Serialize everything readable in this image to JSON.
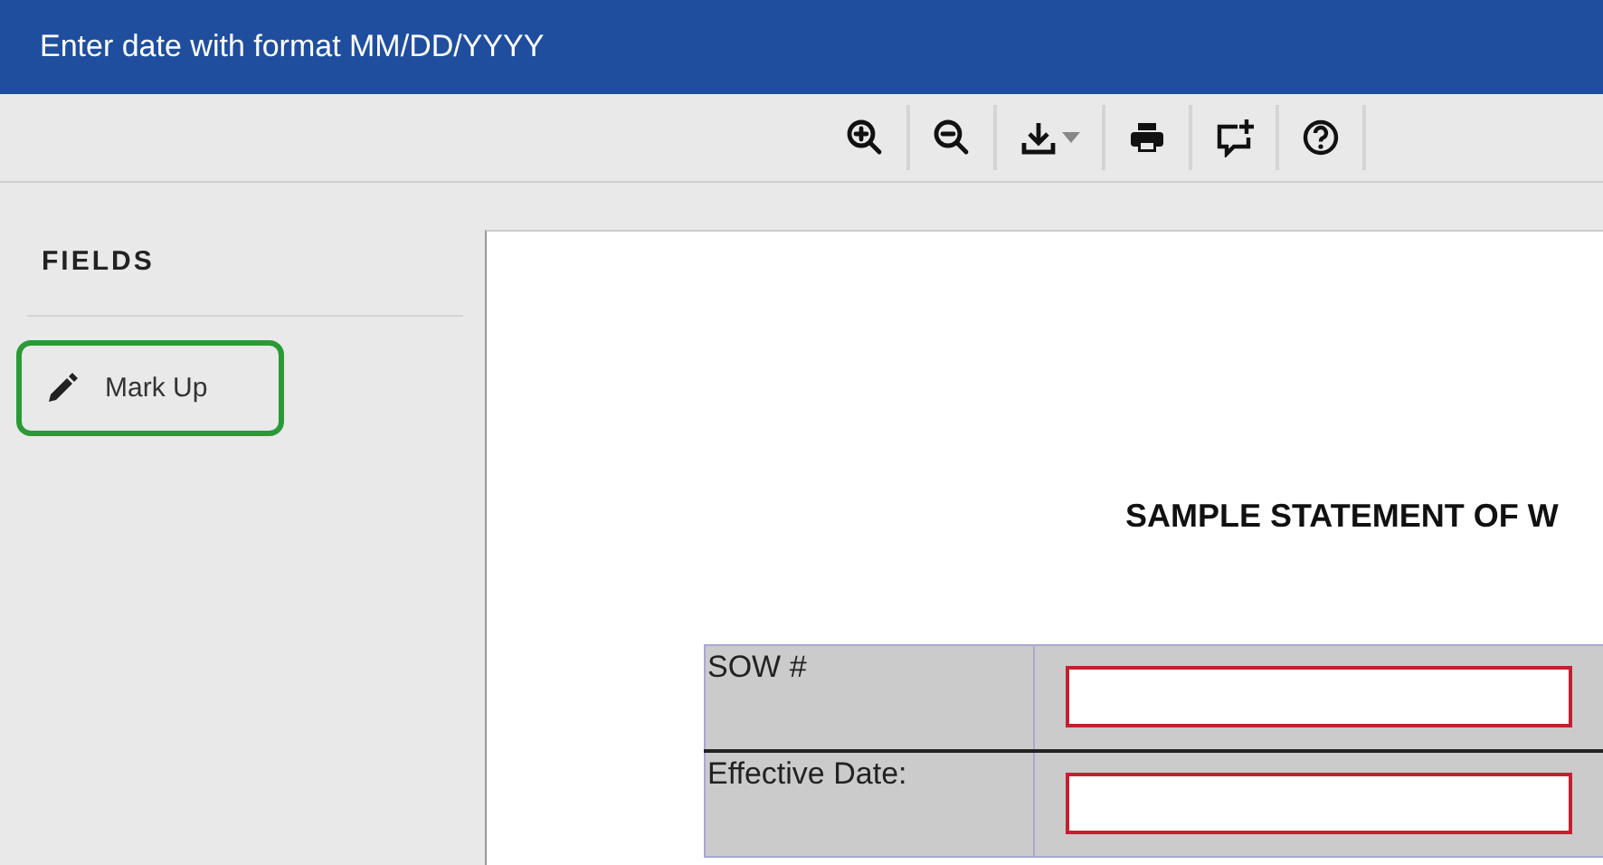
{
  "header": {
    "title": "Enter date with format MM/DD/YYYY"
  },
  "toolbar": {
    "buttons": [
      {
        "kind": "zoom-in"
      },
      {
        "kind": "zoom-out"
      },
      {
        "kind": "download"
      },
      {
        "kind": "print"
      },
      {
        "kind": "comment"
      },
      {
        "kind": "help"
      }
    ]
  },
  "sidebar": {
    "heading": "FIELDS",
    "items": [
      {
        "label": "Mark Up",
        "selected": true
      }
    ]
  },
  "document": {
    "title": "SAMPLE STATEMENT OF W",
    "rows": [
      {
        "label": "SOW #"
      },
      {
        "label": "Effective Date:"
      }
    ]
  }
}
